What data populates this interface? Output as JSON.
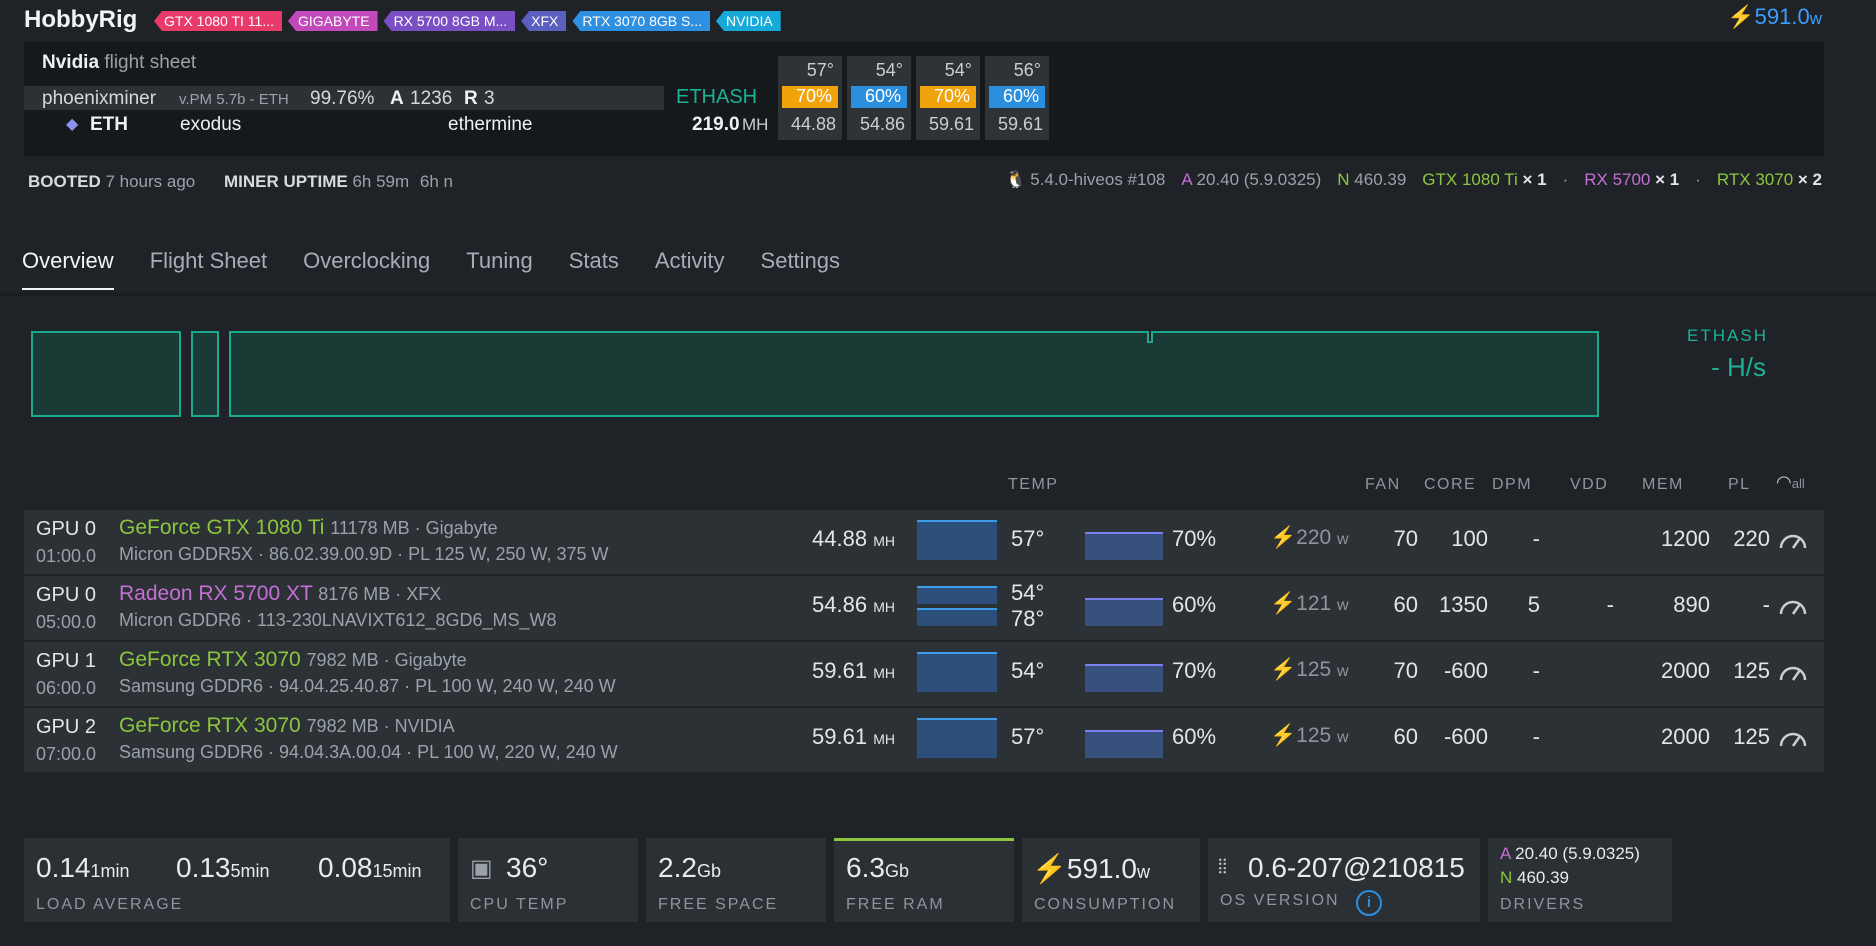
{
  "header": {
    "rig_name": "HobbyRig",
    "tags": [
      {
        "label": "GTX 1080 TI 11...",
        "color": "#e83a6b"
      },
      {
        "label": "GIGABYTE",
        "color": "#c249b9"
      },
      {
        "label": "RX 5700 8GB M...",
        "color": "#7b4fc4"
      },
      {
        "label": "XFX",
        "color": "#5b5fbf"
      },
      {
        "label": "RTX 3070 8GB S...",
        "color": "#2f8fe0"
      },
      {
        "label": "NVIDIA",
        "color": "#17a9d8"
      }
    ],
    "power_value": "591.0",
    "power_unit": "w"
  },
  "flight_sheet": {
    "brand": "Nvidia",
    "label": "flight sheet",
    "miner": "phoenixminer",
    "version": "v.PM 5.7b - ETH",
    "share_rate": "99.76%",
    "accepted_label": "A",
    "accepted": "1236",
    "rejected_label": "R",
    "rejected": "3",
    "algo": "ETHASH",
    "coin": "ETH",
    "wallet": "exodus",
    "pool": "ethermine",
    "hashrate": "219.0",
    "hashrate_unit": "MH",
    "gpus": [
      {
        "temp": "57°",
        "fan": "70%",
        "fan_color": "#f0a30a",
        "hash": "44.88"
      },
      {
        "temp": "54°",
        "fan": "60%",
        "fan_color": "#2b8fe0",
        "hash": "54.86"
      },
      {
        "temp": "54°",
        "fan": "70%",
        "fan_color": "#f0a30a",
        "hash": "59.61"
      },
      {
        "temp": "56°",
        "fan": "60%",
        "fan_color": "#2b8fe0",
        "hash": "59.61"
      }
    ]
  },
  "status": {
    "booted_label": "BOOTED",
    "booted_value": "7 hours ago",
    "uptime_label": "MINER UPTIME",
    "uptime_value": "6h 59m",
    "uptime_value2": "6h n",
    "os_kernel": "5.4.0-hiveos #108",
    "amd_letter": "A",
    "amd_driver": "20.40 (5.9.0325)",
    "nv_letter": "N",
    "nv_driver": "460.39",
    "cards": [
      {
        "name": "GTX 1080 Ti",
        "count": "× 1",
        "color": "#8cc63f"
      },
      {
        "name": "RX 5700",
        "count": "× 1",
        "color": "#c46fd4"
      },
      {
        "name": "RTX 3070",
        "count": "× 2",
        "color": "#8cc63f"
      }
    ]
  },
  "tabs": [
    "Overview",
    "Flight Sheet",
    "Overclocking",
    "Tuning",
    "Stats",
    "Activity",
    "Settings"
  ],
  "chart": {
    "algo": "ETHASH",
    "rate": "- H/s"
  },
  "table": {
    "headers": {
      "temp": "TEMP",
      "fan": "FAN",
      "core": "CORE",
      "dpm": "DPM",
      "vdd": "VDD",
      "mem": "MEM",
      "pl": "PL",
      "all": "all"
    },
    "rows": [
      {
        "idx": "GPU 0",
        "bus": "01:00.0",
        "name": "GeForce GTX 1080 Ti",
        "name_color": "#8cc63f",
        "vram": "11178 MB · Gigabyte",
        "mem": "Micron GDDR5X · 86.02.39.00.9D · PL 125 W, 250 W, 375 W",
        "hash": "44.88",
        "hash_unit": "MH",
        "temp": "57°",
        "temp2": "",
        "fan": "70%",
        "power": "220",
        "power_unit": "w",
        "c_fan": "70",
        "c_core": "100",
        "c_dpm": "-",
        "c_vdd": "",
        "c_mem": "1200",
        "c_pl": "220"
      },
      {
        "idx": "GPU 0",
        "bus": "05:00.0",
        "name": "Radeon RX 5700 XT",
        "name_color": "#c46fd4",
        "vram": "8176 MB · XFX",
        "mem": "Micron GDDR6 · 113-230LNAVIXT612_8GD6_MS_W8",
        "hash": "54.86",
        "hash_unit": "MH",
        "temp": "54°",
        "temp2": "78°",
        "fan": "60%",
        "power": "121",
        "power_unit": "w",
        "c_fan": "60",
        "c_core": "1350",
        "c_dpm": "5",
        "c_vdd": "-",
        "c_mem": "890",
        "c_pl": "-"
      },
      {
        "idx": "GPU 1",
        "bus": "06:00.0",
        "name": "GeForce RTX 3070",
        "name_color": "#8cc63f",
        "vram": "7982 MB · Gigabyte",
        "mem": "Samsung GDDR6 · 94.04.25.40.87 · PL 100 W, 240 W, 240 W",
        "hash": "59.61",
        "hash_unit": "MH",
        "temp": "54°",
        "temp2": "",
        "fan": "70%",
        "power": "125",
        "power_unit": "w",
        "c_fan": "70",
        "c_core": "-600",
        "c_dpm": "-",
        "c_vdd": "",
        "c_mem": "2000",
        "c_pl": "125"
      },
      {
        "idx": "GPU 2",
        "bus": "07:00.0",
        "name": "GeForce RTX 3070",
        "name_color": "#8cc63f",
        "vram": "7982 MB · NVIDIA",
        "mem": "Samsung GDDR6 · 94.04.3A.00.04 · PL 100 W, 220 W, 240 W",
        "hash": "59.61",
        "hash_unit": "MH",
        "temp": "57°",
        "temp2": "",
        "fan": "60%",
        "power": "125",
        "power_unit": "w",
        "c_fan": "60",
        "c_core": "-600",
        "c_dpm": "-",
        "c_vdd": "",
        "c_mem": "2000",
        "c_pl": "125"
      }
    ]
  },
  "widgets": {
    "load": {
      "v1": "0.14",
      "u1": "1min",
      "v2": "0.13",
      "u2": "5min",
      "v3": "0.08",
      "u3": "15min",
      "label": "LOAD AVERAGE"
    },
    "cpu_temp": {
      "value": "36°",
      "label": "CPU TEMP"
    },
    "free_space": {
      "value": "2.2",
      "unit": "Gb",
      "label": "FREE SPACE"
    },
    "free_ram": {
      "value": "6.3",
      "unit": "Gb",
      "label": "FREE RAM"
    },
    "consumption": {
      "value": "591.0",
      "unit": "w",
      "label": "CONSUMPTION"
    },
    "os_version": {
      "value": "0.6-207@210815",
      "label": "OS VERSION"
    },
    "drivers": {
      "a_letter": "A",
      "a_value": "20.40 (5.9.0325)",
      "n_letter": "N",
      "n_value": "460.39",
      "label": "DRIVERS"
    }
  }
}
